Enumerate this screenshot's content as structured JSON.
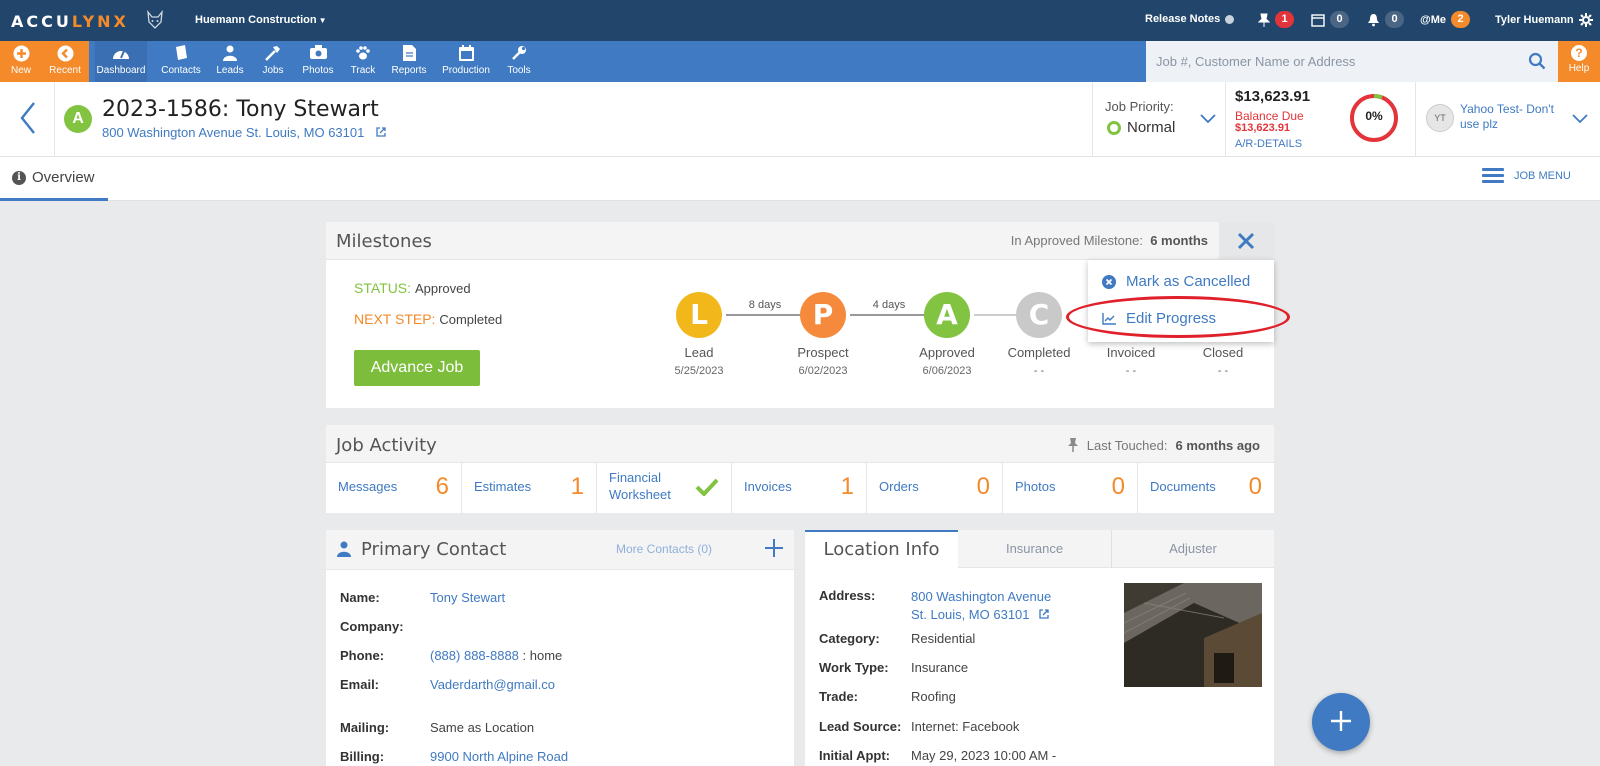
{
  "topbar": {
    "logo_part1": "ACCU",
    "logo_part2": "LYNX",
    "company": "Huemann Construction",
    "release_notes": "Release Notes",
    "pin_count": "1",
    "calendar_count": "0",
    "bell_count": "0",
    "me_label": "@Me",
    "me_count": "2",
    "user": "Tyler Huemann"
  },
  "nav": {
    "items": [
      {
        "label": "New",
        "icon": "plus-circle-icon"
      },
      {
        "label": "Recent",
        "icon": "arrow-left-circle-icon"
      },
      {
        "label": "Dashboard",
        "icon": "gauge-icon"
      },
      {
        "label": "Contacts",
        "icon": "book-icon"
      },
      {
        "label": "Leads",
        "icon": "person-icon"
      },
      {
        "label": "Jobs",
        "icon": "hammer-icon"
      },
      {
        "label": "Photos",
        "icon": "camera-icon"
      },
      {
        "label": "Track",
        "icon": "paw-icon"
      },
      {
        "label": "Reports",
        "icon": "document-icon"
      },
      {
        "label": "Production",
        "icon": "calendar-icon"
      },
      {
        "label": "Tools",
        "icon": "wrench-icon"
      }
    ],
    "search_placeholder": "Job #, Customer Name or Address",
    "help": "Help"
  },
  "job": {
    "stage_letter": "A",
    "title": "2023-1586: Tony Stewart",
    "address": "800 Washington Avenue St. Louis, MO 63101",
    "priority_label": "Job Priority:",
    "priority": "Normal",
    "amount": "$13,623.91",
    "balance_label": "Balance Due",
    "balance": "$13,623.91",
    "ar_link": "A/R-DETAILS",
    "percent": "0%",
    "user_initials": "YT",
    "user_name": "Yahoo Test- Don't use plz"
  },
  "tabs": {
    "overview": "Overview",
    "job_menu": "JOB MENU"
  },
  "milestones": {
    "title": "Milestones",
    "meta_label": "In Approved Milestone:",
    "meta_value": "6 months",
    "status_key": "STATUS:",
    "status_val": "Approved",
    "next_key": "NEXT STEP:",
    "next_val": "Completed",
    "advance": "Advance Job",
    "nodes": [
      {
        "letter": "L",
        "label": "Lead",
        "date": "5/25/2023",
        "color": "#f2b81b"
      },
      {
        "letter": "P",
        "label": "Prospect",
        "date": "6/02/2023",
        "color": "#f58a3c"
      },
      {
        "letter": "A",
        "label": "Approved",
        "date": "6/06/2023",
        "color": "#82c341"
      },
      {
        "letter": "C",
        "label": "Completed",
        "date": "- -",
        "color": "#c9c9c9"
      },
      {
        "label": "Invoiced",
        "date": "- -"
      },
      {
        "label": "Closed",
        "date": "- -"
      }
    ],
    "gaps": [
      "8 days",
      "4 days"
    ],
    "menu": {
      "cancel": "Mark as Cancelled",
      "edit": "Edit Progress"
    }
  },
  "activity": {
    "title": "Job Activity",
    "last_touched_label": "Last Touched:",
    "last_touched": "6 months ago",
    "cells": [
      {
        "label": "Messages",
        "count": "6"
      },
      {
        "label": "Estimates",
        "count": "1"
      },
      {
        "label": "Financial Worksheet"
      },
      {
        "label": "Invoices",
        "count": "1"
      },
      {
        "label": "Orders",
        "count": "0"
      },
      {
        "label": "Photos",
        "count": "0"
      },
      {
        "label": "Documents",
        "count": "0"
      }
    ]
  },
  "contact": {
    "title": "Primary Contact",
    "more": "More Contacts (0)",
    "name_k": "Name:",
    "name_v": "Tony Stewart",
    "company_k": "Company:",
    "phone_k": "Phone:",
    "phone_v": "(888) 888-8888",
    "phone_type": " : home",
    "email_k": "Email:",
    "email_v": "Vaderdarth@gmail.co",
    "mailing_k": "Mailing:",
    "mailing_v": "Same as Location",
    "billing_k": "Billing:",
    "billing_v": "9900 North Alpine Road"
  },
  "location": {
    "tab_location": "Location Info",
    "tab_insurance": "Insurance",
    "tab_adjuster": "Adjuster",
    "address_k": "Address:",
    "address_line1": "800 Washington Avenue",
    "address_line2": "St. Louis, MO 63101",
    "category_k": "Category:",
    "category_v": "Residential",
    "worktype_k": "Work Type:",
    "worktype_v": "Insurance",
    "trade_k": "Trade:",
    "trade_v": "Roofing",
    "leadsource_k": "Lead Source:",
    "leadsource_v": "Internet: Facebook",
    "appt_k": "Initial Appt:",
    "appt_v": "May 29, 2023 10:00 AM -"
  }
}
